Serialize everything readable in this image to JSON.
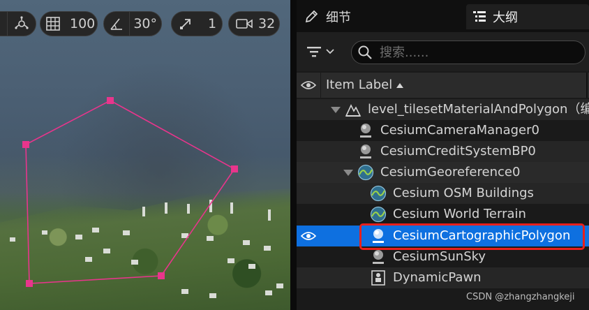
{
  "viewport_toolbar": {
    "grid_value": "100",
    "rotation_snap": "30°",
    "scale_snap": "1",
    "camera_speed": "32"
  },
  "tabs": {
    "details": "细节",
    "outliner": "大纲"
  },
  "search": {
    "placeholder": "搜索......"
  },
  "column": {
    "item_label": "Item Label"
  },
  "outliner_items": [
    {
      "label": "level_tilesetMaterialAndPolygon（编",
      "icon": "level-icon",
      "expanded": true
    },
    {
      "label": "CesiumCameraManager0",
      "icon": "actor-sphere-icon"
    },
    {
      "label": "CesiumCreditSystemBP0",
      "icon": "actor-sphere-icon"
    },
    {
      "label": "CesiumGeoreference0",
      "icon": "cesium-icon",
      "expanded": true
    },
    {
      "label": "Cesium OSM Buildings",
      "icon": "cesium-icon"
    },
    {
      "label": "Cesium World Terrain",
      "icon": "cesium-icon"
    },
    {
      "label": "CesiumCartographicPolygon",
      "icon": "actor-sphere-icon",
      "selected": true
    },
    {
      "label": "CesiumSunSky",
      "icon": "actor-sphere-icon"
    },
    {
      "label": "DynamicPawn",
      "icon": "pawn-icon"
    }
  ],
  "colors": {
    "selection": "#0e70e0",
    "highlight_box": "#e8201c",
    "polygon": "#e8358c"
  },
  "watermark": "CSDN @zhangzhangkeji"
}
